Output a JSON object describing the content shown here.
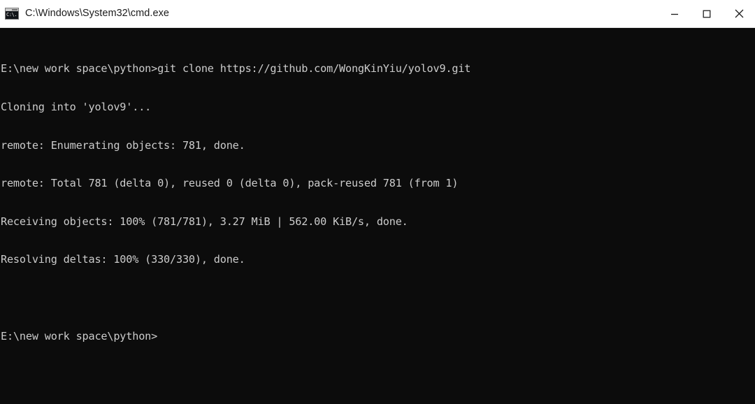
{
  "window": {
    "title": "C:\\Windows\\System32\\cmd.exe",
    "icon": "cmd-console-icon",
    "icon_glyph": "C:\\.",
    "background_color": "#0c0c0c",
    "titlebar_color": "#ffffff",
    "text_color": "#cccccc"
  },
  "titlebar_controls": {
    "minimize_label": "Minimize",
    "maximize_label": "Maximize",
    "close_label": "Close"
  },
  "console": {
    "lines": [
      "E:\\new work space\\python>git clone https://github.com/WongKinYiu/yolov9.git",
      "Cloning into 'yolov9'...",
      "remote: Enumerating objects: 781, done.",
      "remote: Total 781 (delta 0), reused 0 (delta 0), pack-reused 781 (from 1)",
      "Receiving objects: 100% (781/781), 3.27 MiB | 562.00 KiB/s, done.",
      "Resolving deltas: 100% (330/330), done.",
      "",
      "E:\\new work space\\python>"
    ]
  }
}
